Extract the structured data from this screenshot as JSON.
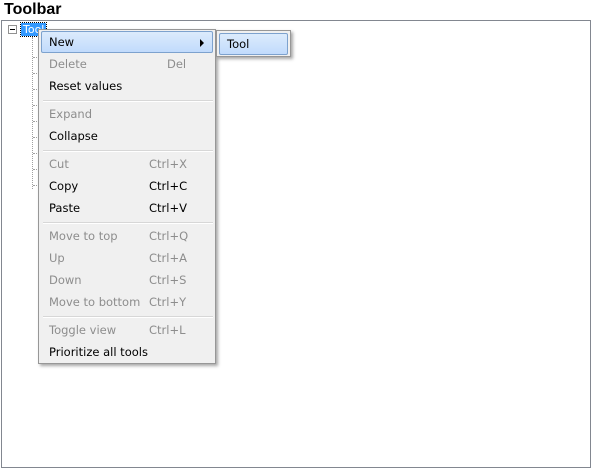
{
  "window": {
    "title": "Toolbar"
  },
  "tree": {
    "root_label": "Tool"
  },
  "context_menu": {
    "items": [
      {
        "label": "New",
        "shortcut": ""
      },
      {
        "label": "Delete",
        "shortcut": "Del"
      },
      {
        "label": "Reset values",
        "shortcut": ""
      },
      {
        "label": "Expand",
        "shortcut": ""
      },
      {
        "label": "Collapse",
        "shortcut": ""
      },
      {
        "label": "Cut",
        "shortcut": "Ctrl+X"
      },
      {
        "label": "Copy",
        "shortcut": "Ctrl+C"
      },
      {
        "label": "Paste",
        "shortcut": "Ctrl+V"
      },
      {
        "label": "Move to top",
        "shortcut": "Ctrl+Q"
      },
      {
        "label": "Up",
        "shortcut": "Ctrl+A"
      },
      {
        "label": "Down",
        "shortcut": "Ctrl+S"
      },
      {
        "label": "Move to bottom",
        "shortcut": "Ctrl+Y"
      },
      {
        "label": "Toggle view",
        "shortcut": "Ctrl+L"
      },
      {
        "label": "Prioritize all tools",
        "shortcut": ""
      }
    ]
  },
  "submenu": {
    "items": [
      {
        "label": "Tool"
      }
    ]
  },
  "colors": {
    "selection": "#3399ff",
    "menu_background": "#f0f0f0",
    "menu_highlight": "#c1dbfc",
    "disabled_text": "#8d8d8d"
  }
}
